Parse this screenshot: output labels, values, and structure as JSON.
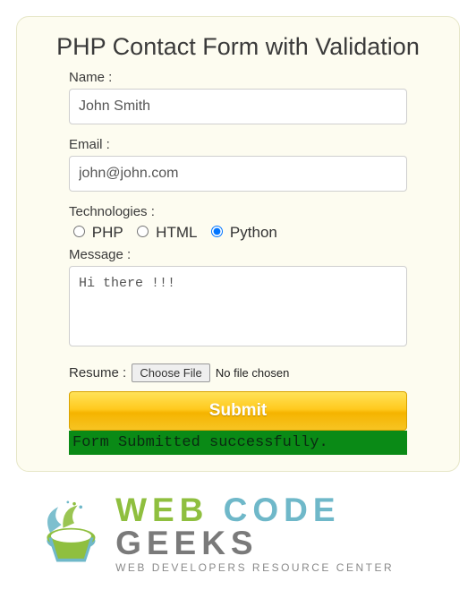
{
  "form": {
    "title": "PHP Contact Form with Validation",
    "name_label": "Name :",
    "name_value": "John Smith",
    "email_label": "Email :",
    "email_value": "john@john.com",
    "tech_label": "Technologies :",
    "tech": {
      "php": {
        "label": "PHP",
        "checked": false
      },
      "html": {
        "label": "HTML",
        "checked": false
      },
      "python": {
        "label": "Python",
        "checked": true
      }
    },
    "message_label": "Message :",
    "message_value": "Hi there !!!",
    "resume_label": "Resume :",
    "file_button": "Choose File",
    "file_status": "No file chosen",
    "submit_label": "Submit",
    "success_message": "Form Submitted successfully."
  },
  "brand": {
    "word1": "WEB",
    "word2": "CODE",
    "word3": "GEEKS",
    "tagline": "WEB DEVELOPERS RESOURCE CENTER"
  }
}
